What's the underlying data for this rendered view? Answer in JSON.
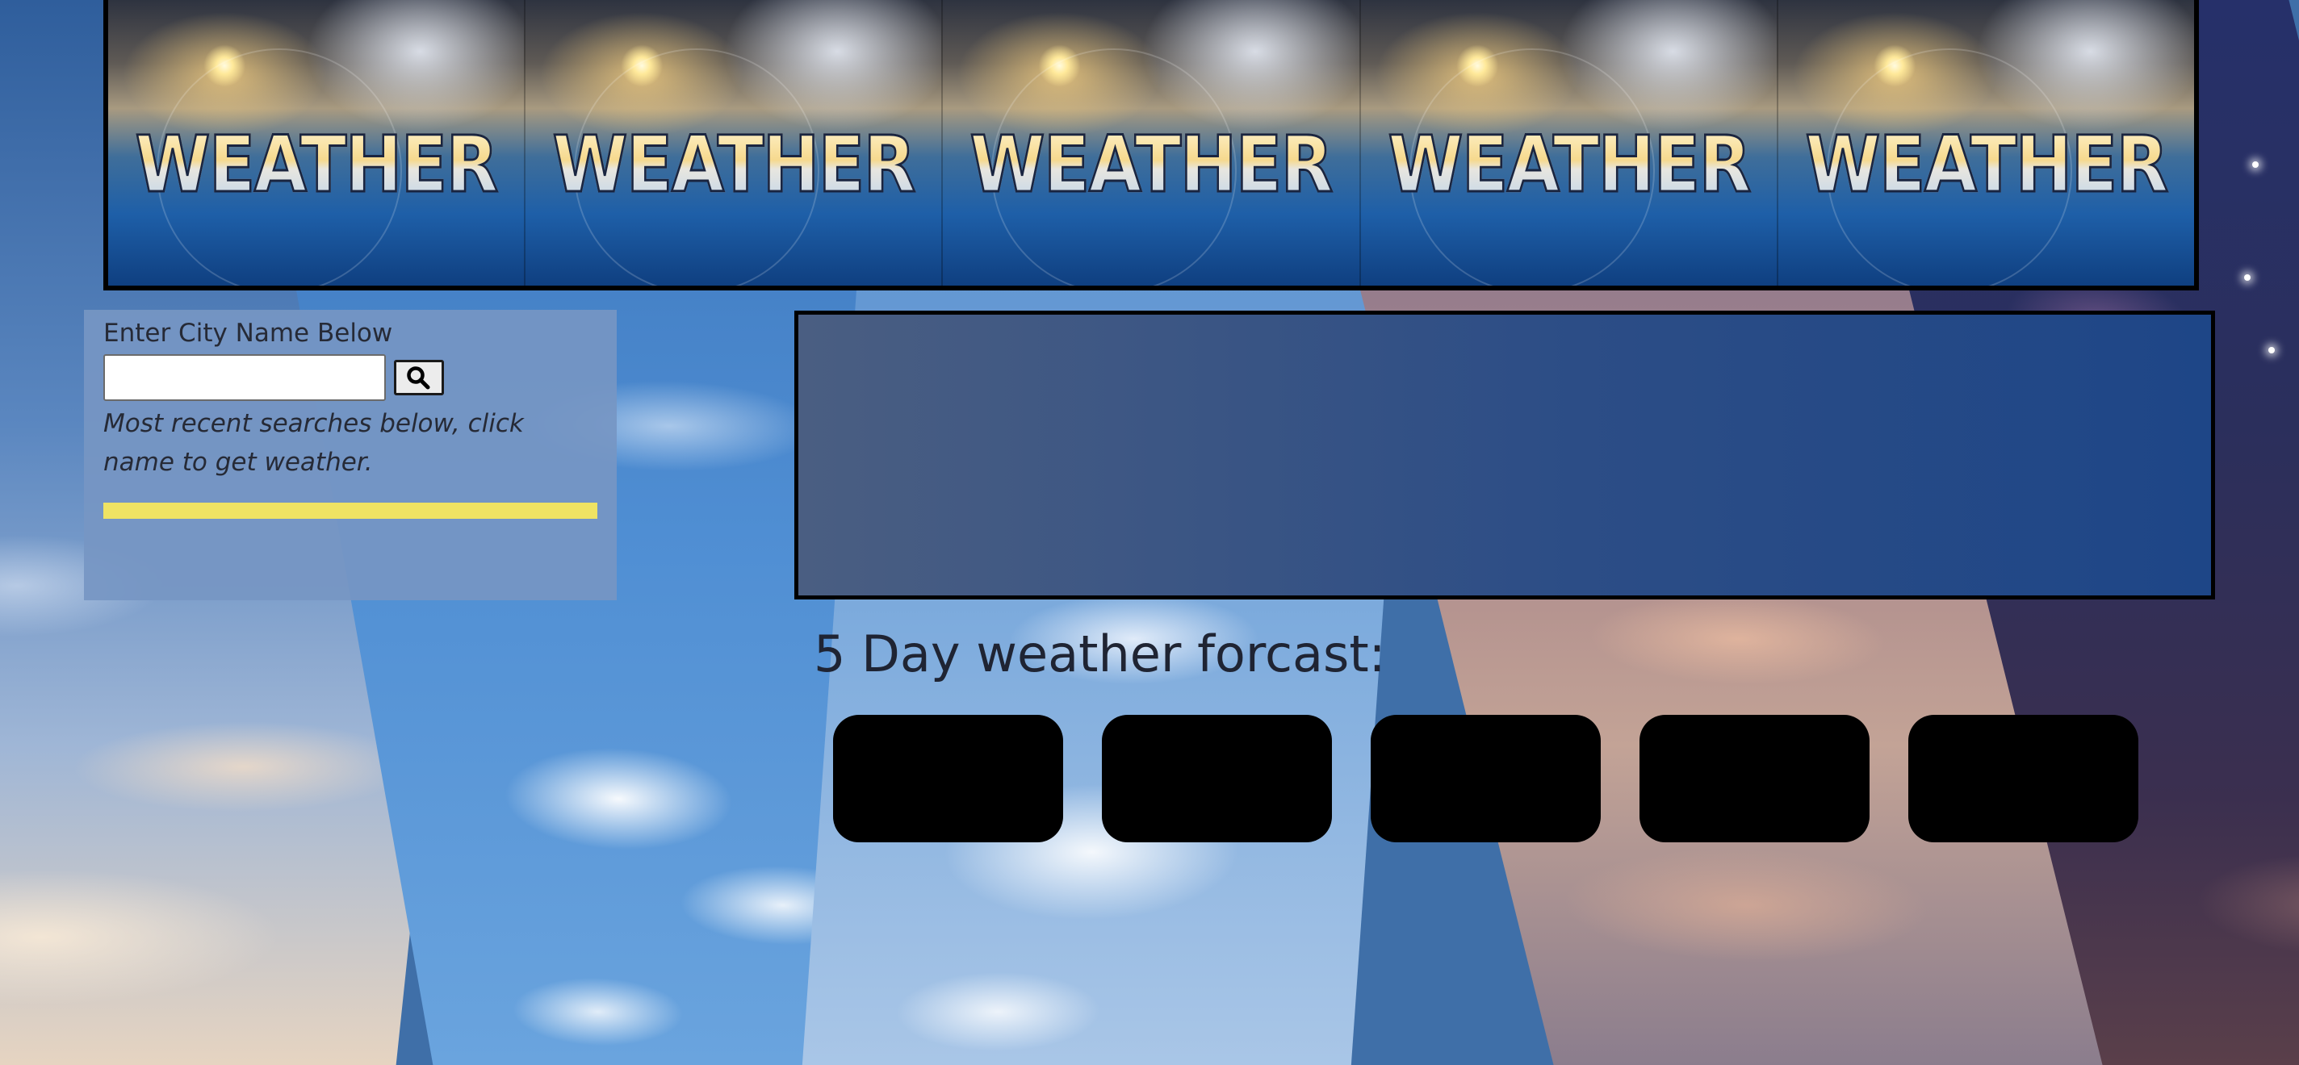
{
  "header": {
    "logo_text": "WEATHER",
    "tiles": [
      1,
      2,
      3,
      4,
      5
    ]
  },
  "search": {
    "prompt": "Enter City Name Below",
    "input_value": "",
    "input_placeholder": "",
    "button_icon": "search-icon",
    "hint": "Most recent searches below, click name to get weather.",
    "recent_searches": []
  },
  "current_weather": {},
  "forecast": {
    "heading": "5 Day weather forcast:",
    "cards": [
      "",
      "",
      "",
      "",
      ""
    ]
  },
  "colors": {
    "header_border": "#000000",
    "panel_bg": "#7696c3",
    "recent_bar": "#efe363",
    "current_box_from": "#4a5e82",
    "current_box_to": "#1e4687",
    "forecast_card": "#000000",
    "text": "#1f2433"
  }
}
